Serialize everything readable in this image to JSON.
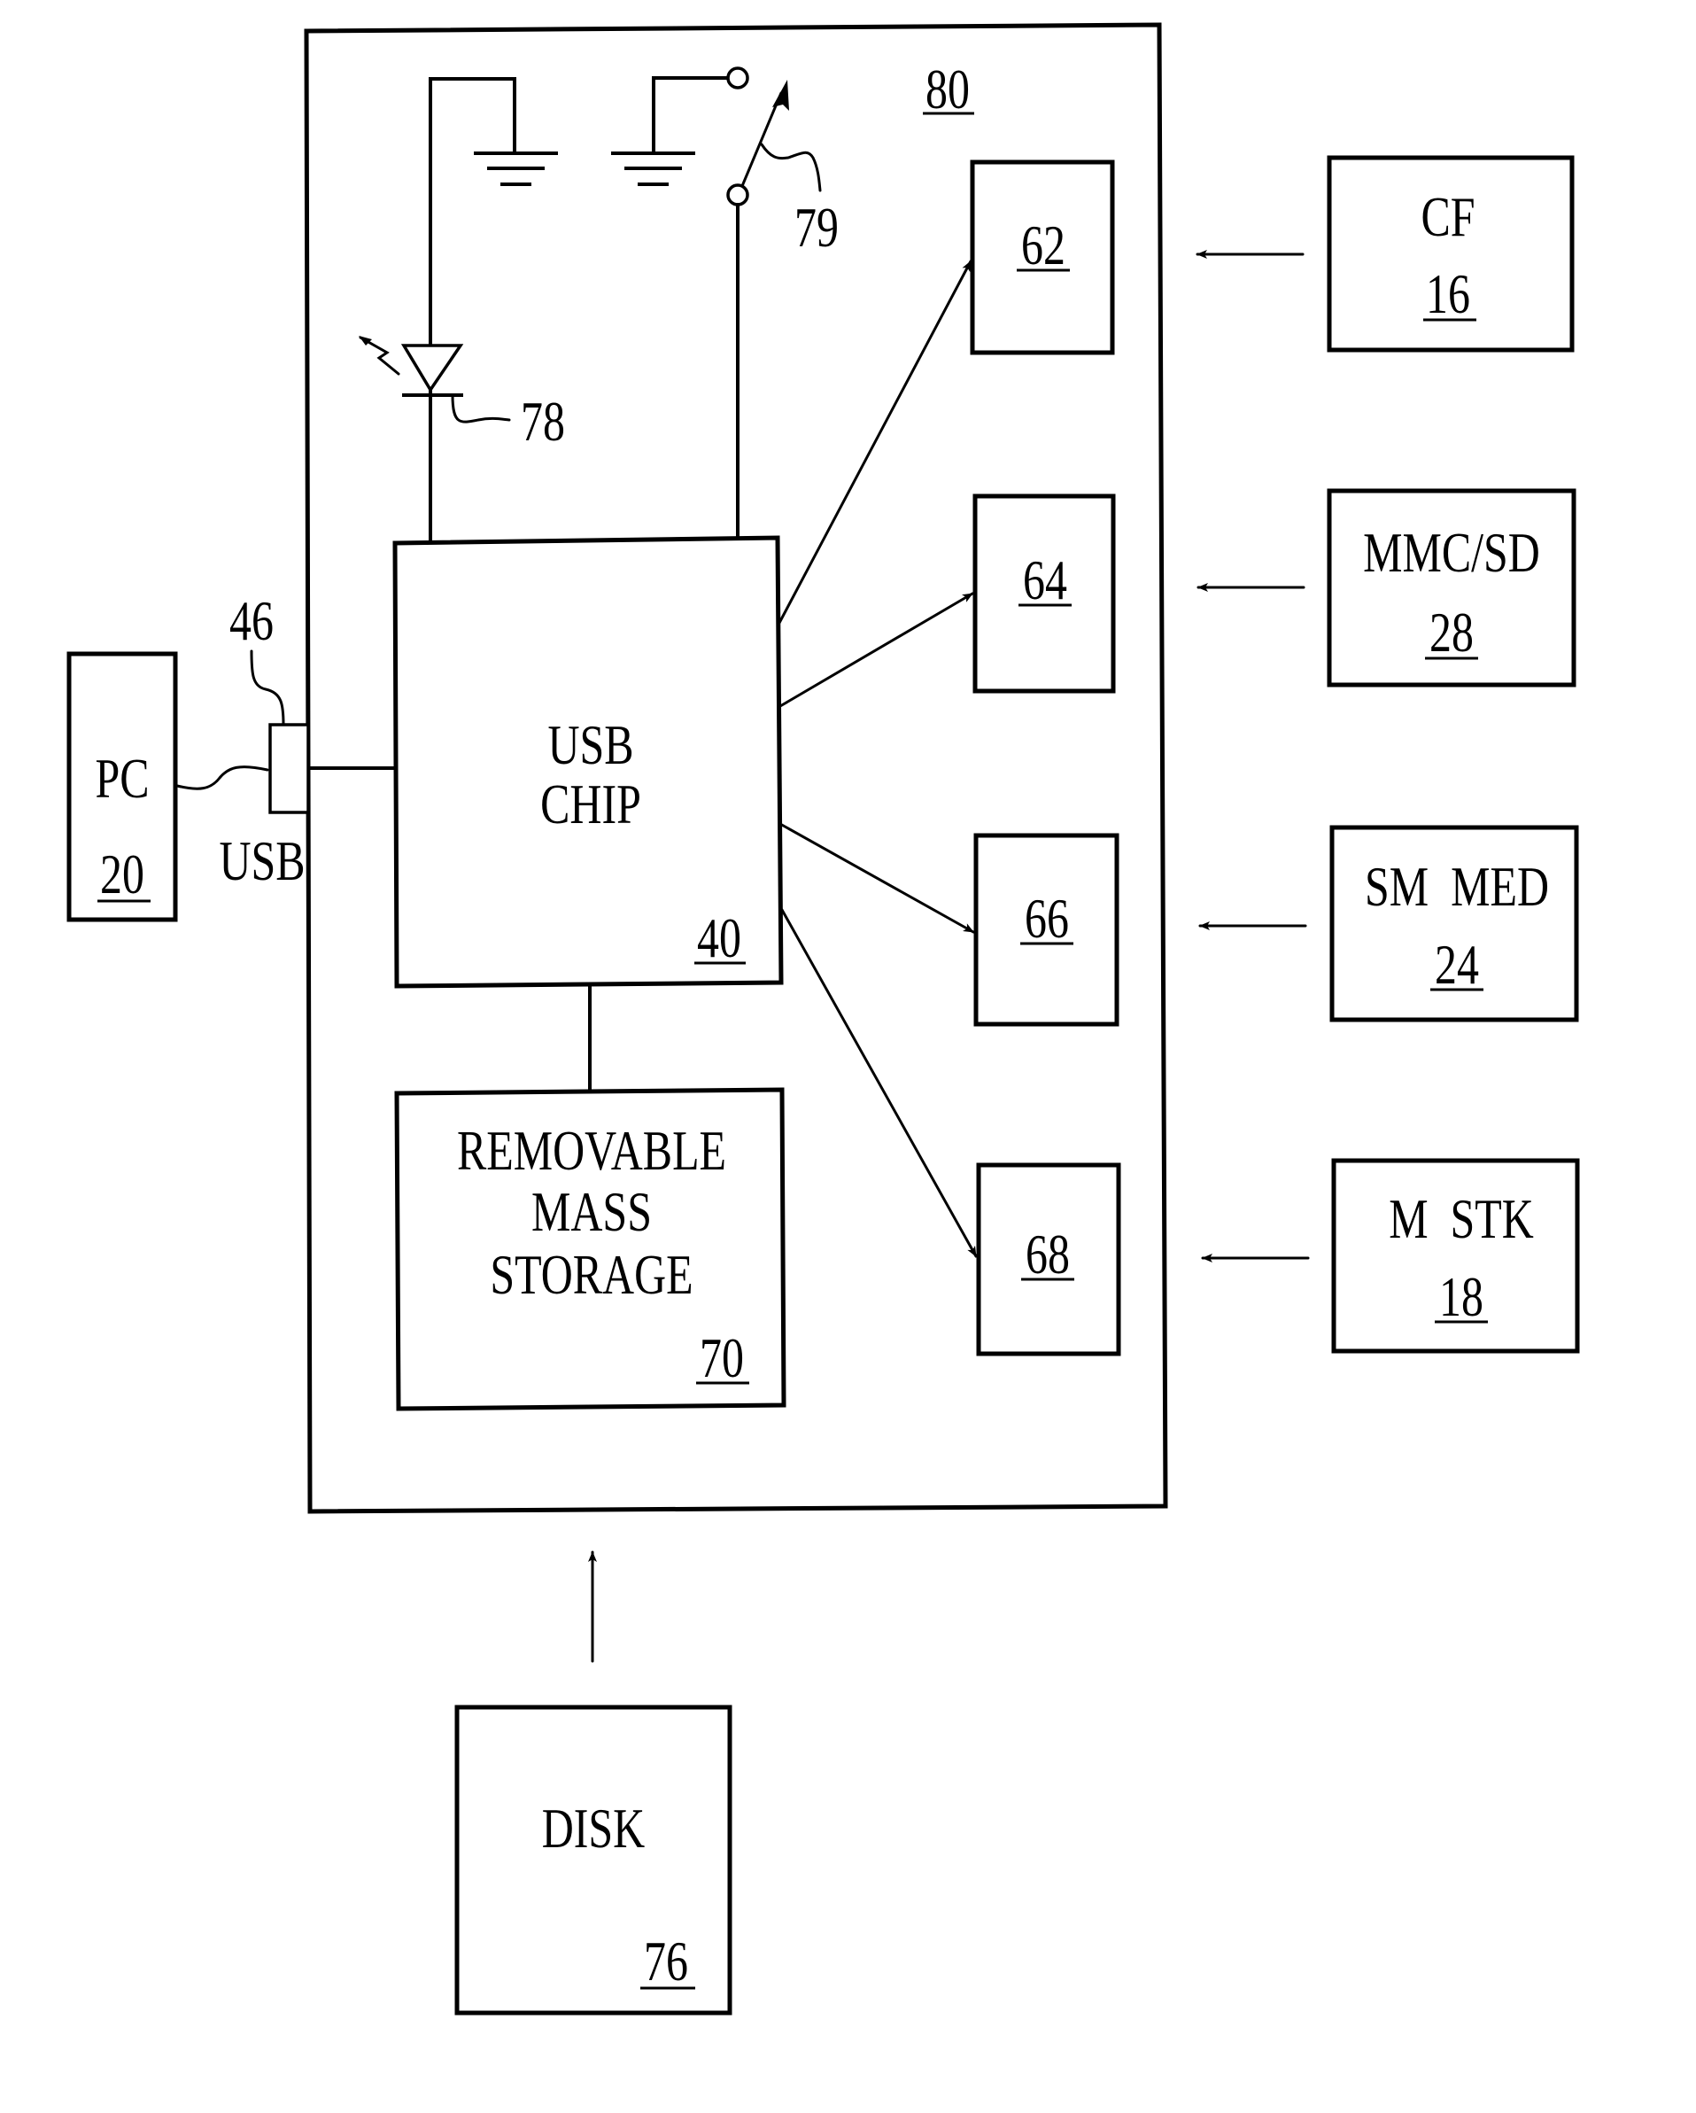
{
  "figure": {
    "enclosure": {
      "ref": "80"
    },
    "usb_chip": {
      "line1": "USB",
      "line2": "CHIP",
      "ref": "40"
    },
    "storage": {
      "line1": "REMOVABLE",
      "line2": "MASS",
      "line3": "STORAGE",
      "ref": "70"
    },
    "pc": {
      "label": "PC",
      "ref": "20"
    },
    "usb_connector": {
      "label": "USB",
      "ref": "46"
    },
    "led": {
      "ref": "78"
    },
    "switch": {
      "ref": "79"
    },
    "slots": [
      {
        "ref": "62"
      },
      {
        "ref": "64"
      },
      {
        "ref": "66"
      },
      {
        "ref": "68"
      }
    ],
    "media": [
      {
        "label": "CF",
        "ref": "16"
      },
      {
        "label": "MMC/SD",
        "ref": "28"
      },
      {
        "label": "SM  MED",
        "ref": "24"
      },
      {
        "label": "M  STK",
        "ref": "18"
      }
    ],
    "disk": {
      "label": "DISK",
      "ref": "76"
    }
  }
}
